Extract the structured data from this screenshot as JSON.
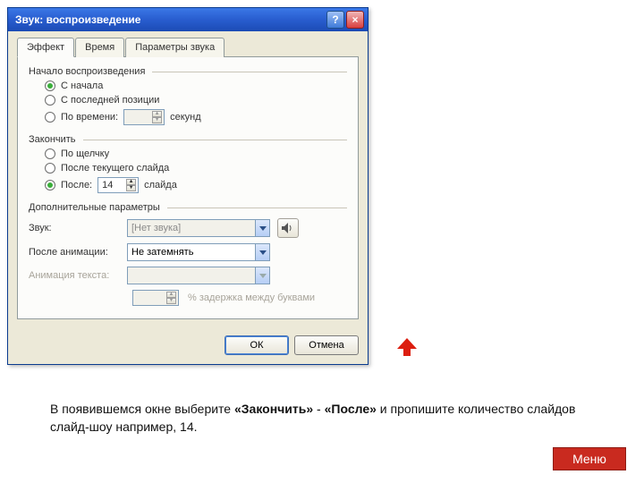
{
  "dialog": {
    "title": "Звук: воспроизведение",
    "tabs": [
      "Эффект",
      "Время",
      "Параметры звука"
    ],
    "active_tab": 0,
    "group_start": {
      "label": "Начало воспроизведения",
      "options": {
        "from_start": "С начала",
        "from_last": "С последней позиции",
        "by_time": "По времени:",
        "by_time_value": "",
        "by_time_unit": "секунд"
      },
      "selected": "from_start"
    },
    "group_end": {
      "label": "Закончить",
      "options": {
        "on_click": "По щелчку",
        "after_current": "После текущего слайда",
        "after": "После:",
        "after_value": "14",
        "after_unit": "слайда"
      },
      "selected": "after"
    },
    "group_extra": {
      "label": "Дополнительные параметры",
      "sound_label": "Звук:",
      "sound_value": "[Нет звука]",
      "after_anim_label": "После анимации:",
      "after_anim_value": "Не затемнять",
      "text_anim_label": "Анимация текста:",
      "text_anim_value": "",
      "pct_delay_value": "",
      "pct_delay_hint": "% задержка между буквами"
    },
    "buttons": {
      "ok": "ОК",
      "cancel": "Отмена"
    }
  },
  "caption": {
    "pre": "В появившемся окне выберите ",
    "b1": "«Закончить»",
    "mid": " - ",
    "b2": "«После»",
    "post": " и пропишите количество слайдов  слайд-шоу например, 14."
  },
  "menu_label": "Меню",
  "colors": {
    "accent": "#c92a1f"
  }
}
